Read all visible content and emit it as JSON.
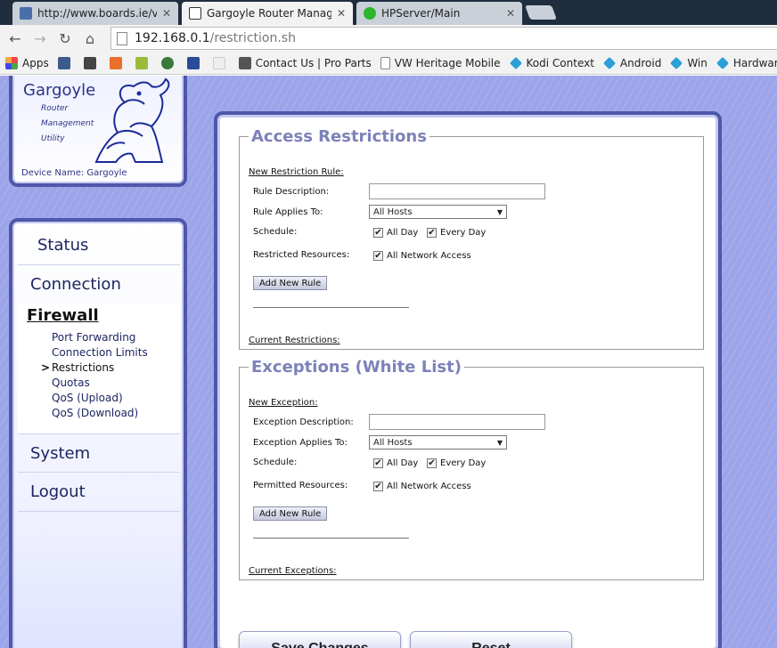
{
  "browser": {
    "tabs": [
      {
        "title": "http://www.boards.ie/vbul",
        "active": false
      },
      {
        "title": "Gargoyle Router Manager",
        "active": true
      },
      {
        "title": "HPServer/Main",
        "active": false
      }
    ],
    "url_host": "192.168.0.1",
    "url_path": "/restriction.sh",
    "bookmarks": [
      {
        "label": "Apps",
        "icon": "apps-grid-icon"
      },
      {
        "label": "",
        "icon": "bookmark-icon-1"
      },
      {
        "label": "",
        "icon": "bookmark-icon-g"
      },
      {
        "label": "",
        "icon": "bookmark-icon-j"
      },
      {
        "label": "",
        "icon": "bookmark-icon-lh"
      },
      {
        "label": "",
        "icon": "bookmark-icon-eye"
      },
      {
        "label": "",
        "icon": "bookmark-icon-globe"
      },
      {
        "label": "",
        "icon": "bookmark-icon-xda"
      },
      {
        "label": "Contact Us | Pro Parts",
        "icon": "bookmark-icon-photo"
      },
      {
        "label": "VW Heritage Mobile",
        "icon": "page-icon"
      },
      {
        "label": "Kodi Context",
        "icon": "kodi-icon"
      },
      {
        "label": "Android",
        "icon": "kodi-icon"
      },
      {
        "label": "Win",
        "icon": "kodi-icon"
      },
      {
        "label": "Hardware",
        "icon": "kodi-icon"
      }
    ]
  },
  "logo": {
    "title": "Gargoyle",
    "sub1": "Router",
    "sub2": "Management",
    "sub3": "Utility",
    "device_name": "Device Name: Gargoyle"
  },
  "nav": {
    "status": "Status",
    "connection": "Connection",
    "firewall": "Firewall",
    "sub": [
      "Port Forwarding",
      "Connection Limits",
      "Restrictions",
      "Quotas",
      "QoS (Upload)",
      "QoS (Download)"
    ],
    "current_marker": ">",
    "system": "System",
    "logout": "Logout"
  },
  "access": {
    "title": "Access Restrictions",
    "new_label": "New Restriction Rule:",
    "desc_label": "Rule Description:",
    "desc_value": "",
    "applies_label": "Rule Applies To:",
    "applies_value": "All Hosts",
    "schedule_label": "Schedule:",
    "all_day": "All Day",
    "every_day": "Every Day",
    "resources_label": "Restricted Resources:",
    "all_network": "All Network Access",
    "add_button": "Add New Rule",
    "current_label": "Current Restrictions:"
  },
  "exceptions": {
    "title": "Exceptions (White List)",
    "new_label": "New Exception:",
    "desc_label": "Exception Description:",
    "desc_value": "",
    "applies_label": "Exception Applies To:",
    "applies_value": "All Hosts",
    "schedule_label": "Schedule:",
    "all_day": "All Day",
    "every_day": "Every Day",
    "resources_label": "Permitted Resources:",
    "all_network": "All Network Access",
    "add_button": "Add New Rule",
    "current_label": "Current Exceptions:"
  },
  "actions": {
    "save": "Save Changes",
    "reset": "Reset"
  },
  "checkmark": "✔"
}
